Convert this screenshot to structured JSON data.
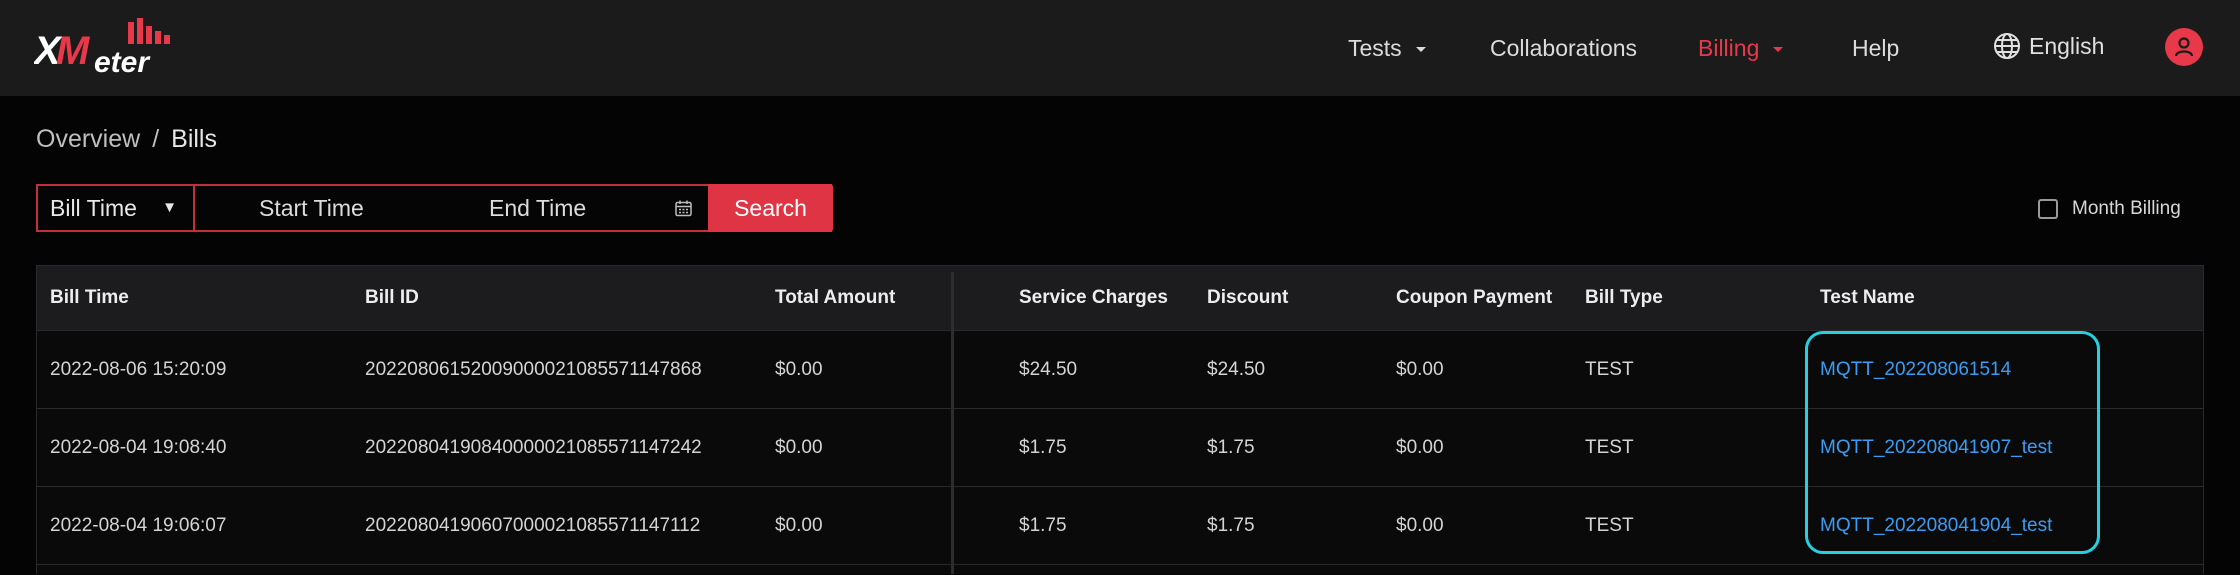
{
  "header": {
    "logo_text": "XMeter",
    "nav": [
      {
        "label": "Tests",
        "has_caret": true,
        "active": false
      },
      {
        "label": "Collaborations",
        "has_caret": false,
        "active": false
      },
      {
        "label": "Billing",
        "has_caret": true,
        "active": true
      },
      {
        "label": "Help",
        "has_caret": false,
        "active": false
      }
    ],
    "language": "English",
    "language_icon": "globe-icon",
    "avatar_icon": "user-icon"
  },
  "breadcrumb": {
    "home": "Overview",
    "separator": "/",
    "current": "Bills"
  },
  "filter": {
    "select_value": "Bill Time",
    "start_placeholder": "Start Time",
    "end_placeholder": "End Time",
    "calendar_icon": "calendar-icon",
    "search_label": "Search",
    "month_billing_label": "Month Billing",
    "month_billing_checked": false
  },
  "table": {
    "columns": [
      "Bill Time",
      "Bill ID",
      "Total Amount",
      "Service Charges",
      "Discount",
      "Coupon Payment",
      "Bill Type",
      "Test Name"
    ],
    "rows": [
      [
        "2022-08-06 15:20:09",
        "20220806152009000021085571147868",
        "$0.00",
        "$24.50",
        "$24.50",
        "$0.00",
        "TEST",
        "MQTT_202208061514"
      ],
      [
        "2022-08-04 19:08:40",
        "20220804190840000021085571147242",
        "$0.00",
        "$1.75",
        "$1.75",
        "$0.00",
        "TEST",
        "MQTT_202208041907_test"
      ],
      [
        "2022-08-04 19:06:07",
        "20220804190607000021085571147112",
        "$0.00",
        "$1.75",
        "$1.75",
        "$0.00",
        "TEST",
        "MQTT_202208041904_test"
      ]
    ]
  },
  "colors": {
    "accent": "#e8394a",
    "link": "#3a9cf3",
    "highlight": "#26d0de",
    "header_bg": "#1b1b1c",
    "page_bg": "#040404"
  }
}
